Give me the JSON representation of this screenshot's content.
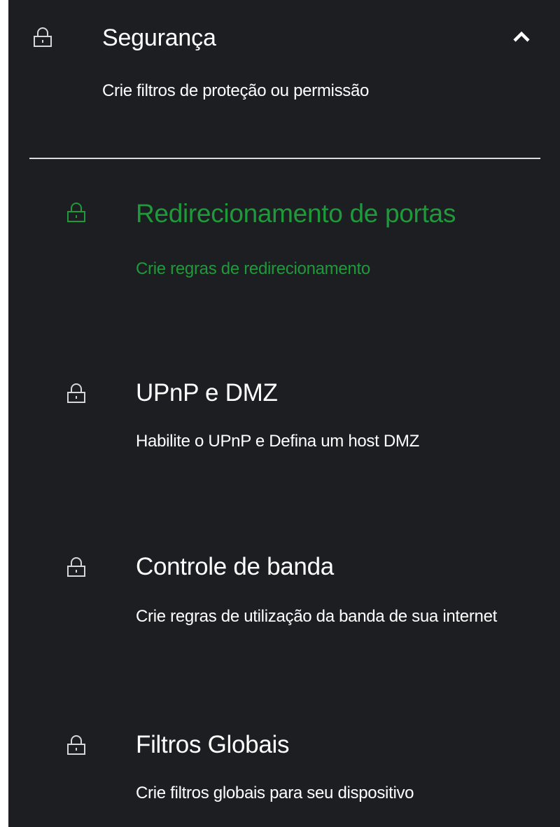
{
  "section": {
    "icon": "lock-icon",
    "title": "Segurança",
    "description": "Crie filtros de proteção ou permissão",
    "toggle_icon": "chevron-up-icon",
    "expanded": true
  },
  "items": [
    {
      "icon": "lock-icon",
      "title": "Redirecionamento de portas",
      "description": "Crie regras de redirecionamento",
      "active": true
    },
    {
      "icon": "lock-icon",
      "title": "UPnP e DMZ",
      "description": "Habilite o UPnP e Defina um host DMZ",
      "active": false
    },
    {
      "icon": "lock-icon",
      "title": "Controle de banda",
      "description": "Crie regras de utilização da banda de sua internet",
      "active": false
    },
    {
      "icon": "lock-icon",
      "title": "Filtros Globais",
      "description": "Crie filtros globais para seu dispositivo",
      "active": false
    }
  ],
  "colors": {
    "background": "#1d1e22",
    "text": "#ffffff",
    "active": "#1f9a3a",
    "divider": "#dcdcdc"
  }
}
